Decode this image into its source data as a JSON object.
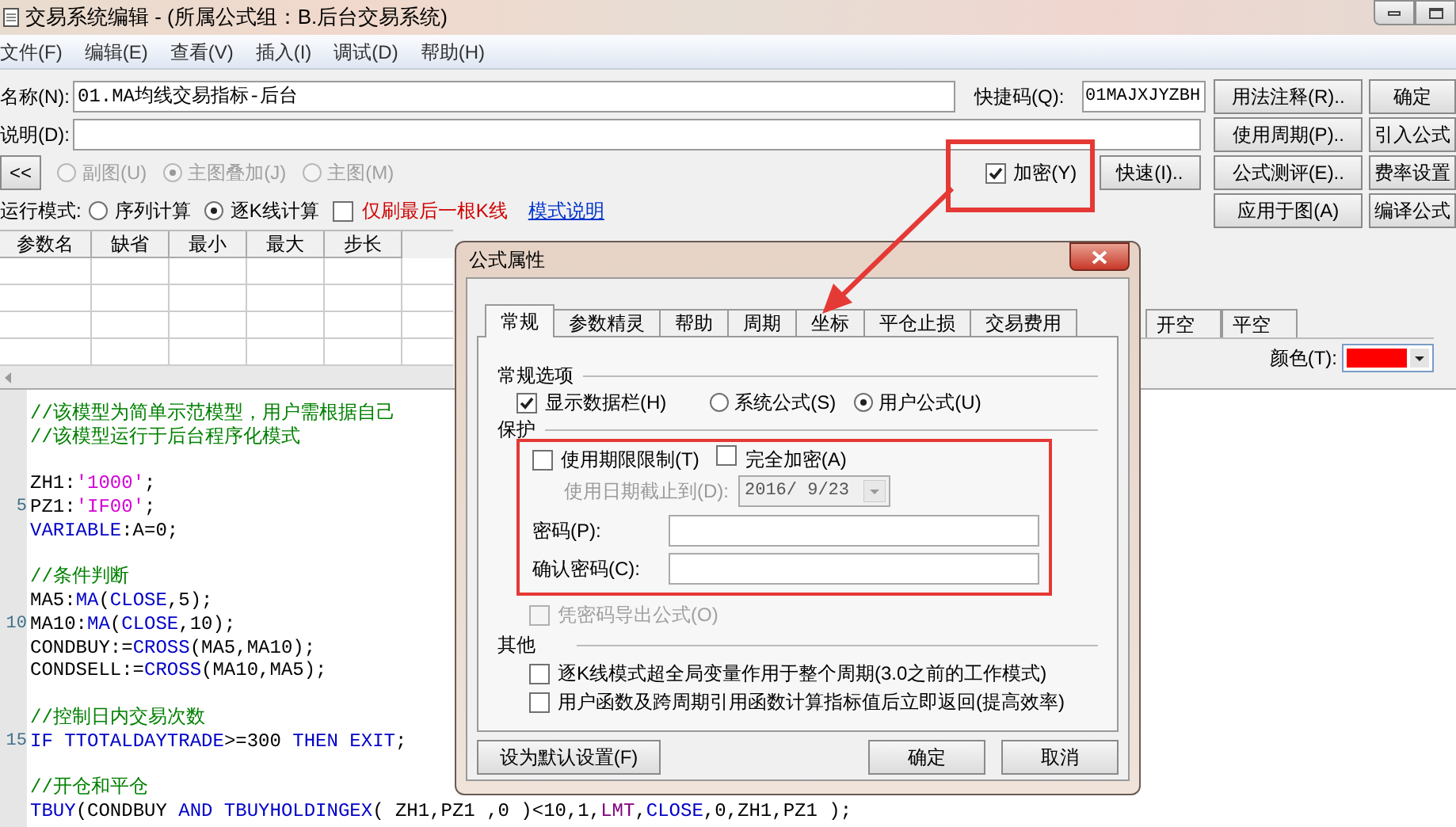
{
  "window": {
    "title": "交易系统编辑 - (所属公式组：B.后台交易系统)"
  },
  "menu": [
    "文件(F)",
    "编辑(E)",
    "查看(V)",
    "插入(I)",
    "调试(D)",
    "帮助(H)"
  ],
  "form": {
    "name": {
      "label": "名称(N):",
      "value": "01.MA均线交易指标-后台"
    },
    "shortcut": {
      "label": "快捷码(Q):",
      "value": "01MAJXJYZBH"
    },
    "description": {
      "label": "说明(D):"
    },
    "collapse_button": "<<",
    "chart_modes": [
      {
        "label": "副图(U)",
        "selected": false,
        "disabled": true
      },
      {
        "label": "主图叠加(J)",
        "selected": true,
        "disabled": true
      },
      {
        "label": "主图(M)",
        "selected": false,
        "disabled": true
      }
    ],
    "encrypt": {
      "label": "加密(Y)",
      "checked": true
    },
    "quick_button": "快速(I)..",
    "run_mode": {
      "label": "运行模式:",
      "options": [
        {
          "label": "序列计算",
          "selected": false
        },
        {
          "label": "逐K线计算",
          "selected": true
        }
      ],
      "last_bar_only": {
        "label": "仅刷最后一根K线",
        "checked": false
      },
      "help_link": "模式说明"
    }
  },
  "side_buttons": [
    [
      "用法注释(R)..",
      "使用周期(P)..",
      "公式测评(E)..",
      "应用于图(A)"
    ],
    [
      "确定",
      "引入公式",
      "费率设置",
      "编译公式"
    ]
  ],
  "params_table": {
    "columns": [
      "参数名",
      "缺省",
      "最小",
      "最大",
      "步长"
    ]
  },
  "line_tabs": [
    "开空",
    "平空"
  ],
  "line_color": {
    "label": "颜色(T):",
    "color": "#ff0000"
  },
  "code": [
    {
      "kind": "code",
      "segments": [
        {
          "kind": "comment",
          "text": "//该模型为简单示范模型，用户需根据自己"
        }
      ]
    },
    {
      "kind": "code",
      "segments": [
        {
          "kind": "comment",
          "text": "//该模型运行于后台程序化模式"
        }
      ]
    },
    {
      "kind": "blank"
    },
    {
      "kind": "code",
      "segments": [
        {
          "kind": "plain",
          "text": "ZH1:"
        },
        {
          "kind": "string",
          "text": "'1000'"
        },
        {
          "kind": "plain",
          "text": ";"
        }
      ]
    },
    {
      "kind": "code",
      "number": "5",
      "segments": [
        {
          "kind": "plain",
          "text": "PZ1:"
        },
        {
          "kind": "string",
          "text": "'IF00'"
        },
        {
          "kind": "plain",
          "text": ";"
        }
      ]
    },
    {
      "kind": "code",
      "segments": [
        {
          "kind": "keyword",
          "text": "VARIABLE"
        },
        {
          "kind": "plain",
          "text": ":A=0;"
        }
      ]
    },
    {
      "kind": "blank"
    },
    {
      "kind": "code",
      "segments": [
        {
          "kind": "comment",
          "text": "//条件判断"
        }
      ]
    },
    {
      "kind": "code",
      "segments": [
        {
          "kind": "plain",
          "text": "MA5:"
        },
        {
          "kind": "keyword",
          "text": "MA"
        },
        {
          "kind": "plain",
          "text": "("
        },
        {
          "kind": "keyword",
          "text": "CLOSE"
        },
        {
          "kind": "plain",
          "text": ",5);"
        }
      ]
    },
    {
      "kind": "code",
      "number": "10",
      "segments": [
        {
          "kind": "plain",
          "text": "MA10:"
        },
        {
          "kind": "keyword",
          "text": "MA"
        },
        {
          "kind": "plain",
          "text": "("
        },
        {
          "kind": "keyword",
          "text": "CLOSE"
        },
        {
          "kind": "plain",
          "text": ",10);"
        }
      ]
    },
    {
      "kind": "code",
      "segments": [
        {
          "kind": "plain",
          "text": "CONDBUY:="
        },
        {
          "kind": "keyword",
          "text": "CROSS"
        },
        {
          "kind": "plain",
          "text": "(MA5,MA10);"
        }
      ]
    },
    {
      "kind": "code",
      "segments": [
        {
          "kind": "plain",
          "text": "CONDSELL:="
        },
        {
          "kind": "keyword",
          "text": "CROSS"
        },
        {
          "kind": "plain",
          "text": "(MA10,MA5);"
        }
      ]
    },
    {
      "kind": "blank"
    },
    {
      "kind": "code",
      "segments": [
        {
          "kind": "comment",
          "text": "//控制日内交易次数"
        }
      ]
    },
    {
      "kind": "code",
      "number": "15",
      "segments": [
        {
          "kind": "keyword",
          "text": "IF"
        },
        {
          "kind": "keyword",
          "text": " TTOTALDAYTRADE"
        },
        {
          "kind": "plain",
          "text": ">=300 "
        },
        {
          "kind": "keyword",
          "text": "THEN"
        },
        {
          "kind": "keyword",
          "text": " EXIT"
        },
        {
          "kind": "plain",
          "text": ";"
        }
      ]
    },
    {
      "kind": "blank"
    },
    {
      "kind": "code",
      "segments": [
        {
          "kind": "comment",
          "text": "//开仓和平仓"
        }
      ]
    },
    {
      "kind": "code",
      "segments": [
        {
          "kind": "keyword",
          "text": "TBUY"
        },
        {
          "kind": "plain",
          "text": "(CONDBUY "
        },
        {
          "kind": "keyword",
          "text": "AND"
        },
        {
          "kind": "keyword",
          "text": " TBUYHOLDINGEX"
        },
        {
          "kind": "plain",
          "text": "( ZH1,PZ1 ,0 )<10,1,"
        },
        {
          "kind": "constant",
          "text": "LMT"
        },
        {
          "kind": "plain",
          "text": ","
        },
        {
          "kind": "keyword",
          "text": "CLOSE"
        },
        {
          "kind": "plain",
          "text": ",0,ZH1,PZ1 );"
        }
      ]
    }
  ],
  "dialog": {
    "title": "公式属性",
    "tabs": [
      {
        "label": "常规",
        "selected": true
      },
      {
        "label": "参数精灵",
        "selected": false
      },
      {
        "label": "帮助",
        "selected": false
      },
      {
        "label": "周期",
        "selected": false
      },
      {
        "label": "坐标",
        "selected": false
      },
      {
        "label": "平仓止损",
        "selected": false
      },
      {
        "label": "交易费用",
        "selected": false
      }
    ],
    "general": {
      "title": "常规选项",
      "show_data_bar": {
        "label": "显示数据栏(H)",
        "checked": true
      },
      "formula_type": [
        {
          "label": "系统公式(S)",
          "selected": false
        },
        {
          "label": "用户公式(U)",
          "selected": true
        }
      ]
    },
    "protection": {
      "title": "保护",
      "time_limit": {
        "label": "使用期限限制(T)",
        "checked": false
      },
      "full_encrypt": {
        "label": "完全加密(A)",
        "checked": false
      },
      "expiry": {
        "label": "使用日期截止到(D):",
        "value": "2016/ 9/23",
        "disabled": true
      },
      "password": {
        "label": "密码(P):"
      },
      "confirm_password": {
        "label": "确认密码(C):"
      },
      "export_with_password": {
        "label": "凭密码导出公式(O)",
        "checked": false,
        "disabled": true
      }
    },
    "other": {
      "title": "其他",
      "options": [
        {
          "label": "逐K线模式超全局变量作用于整个周期(3.0之前的工作模式)",
          "checked": false
        },
        {
          "label": "用户函数及跨周期引用函数计算指标值后立即返回(提高效率)",
          "checked": false
        }
      ]
    },
    "default_button": "设为默认设置(F)",
    "ok_button": "确定",
    "cancel_button": "取消"
  },
  "annotations": [
    {
      "kind": "box"
    },
    {
      "kind": "box"
    },
    {
      "kind": "arrow"
    }
  ]
}
